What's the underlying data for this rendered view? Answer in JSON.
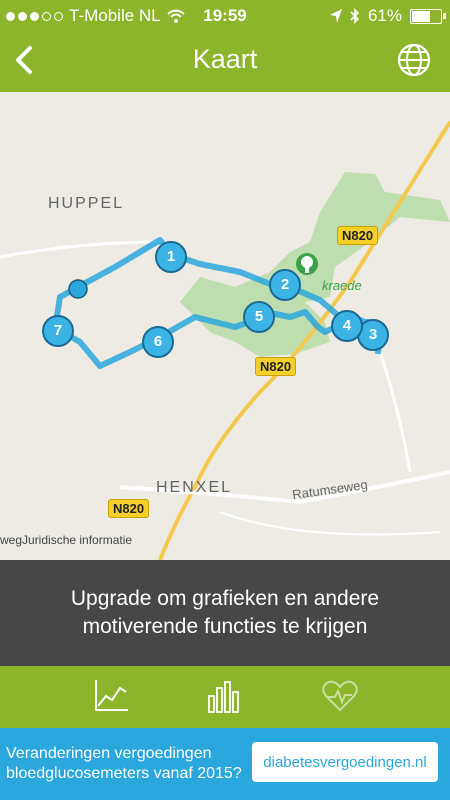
{
  "status": {
    "carrier": "T-Mobile NL",
    "time": "19:59",
    "battery": "61%"
  },
  "nav": {
    "title": "Kaart"
  },
  "map": {
    "places": [
      "HUPPEL",
      "HENXEL",
      "kraede"
    ],
    "roads": [
      "N820",
      "N820",
      "N820",
      "Ratumseweg"
    ],
    "legal": "Juridische informatie",
    "legal_prefix": "weg",
    "waypoints": [
      "1",
      "2",
      "3",
      "4",
      "5",
      "6",
      "7"
    ]
  },
  "upgrade": {
    "text": "Upgrade om grafieken en andere motiverende functies te krijgen"
  },
  "tabs": [
    "line-chart-icon",
    "bar-chart-icon",
    "heart-icon"
  ],
  "ad": {
    "line1": "Veranderingen vergoedingen",
    "line2": "bloedglucosemeters vanaf 2015?",
    "button": "diabetesvergoedingen.nl"
  }
}
